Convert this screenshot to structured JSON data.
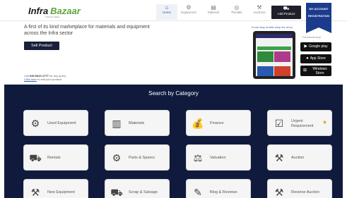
{
  "header": {
    "logo_part1": "Infra",
    "logo_part2": "Bazaar",
    "tagline": "Trees for Value",
    "nav": [
      {
        "label": "Home",
        "icon": "home-icon",
        "glyph": "⌂"
      },
      {
        "label": "Equipment",
        "icon": "gear-icon",
        "glyph": "⚙"
      },
      {
        "label": "Material",
        "icon": "box-icon",
        "glyph": "▤"
      },
      {
        "label": "Rentals",
        "icon": "rentals-icon",
        "glyph": "◎"
      },
      {
        "label": "Auctions",
        "icon": "gavel-icon",
        "glyph": "⚒"
      }
    ],
    "add_product_label": "Add Product",
    "add_product_glyph": "⛟",
    "account_label_1": "MY ACCOUNT",
    "account_label_2": "REGISTRATION"
  },
  "hero": {
    "line1": "A first of its kind marketplace for materials and equipment",
    "line2": "across the Infra sector",
    "sell_button": "Sell Product",
    "call_prefix": "Call",
    "call_number": "040 6610 1777",
    "call_suffix": "for any query",
    "click_link": "Click here",
    "click_suffix": "to add your product"
  },
  "app": {
    "tagline": "A one stop mobile shop for all yo",
    "download_label": "Download App",
    "google_play": "Google play",
    "app_store": "App Store",
    "windows_store_1": "Windows",
    "windows_store_2": "Store"
  },
  "categories": {
    "title": "Search by Category",
    "items": [
      {
        "label": "Used Equipment",
        "glyph": "⚙"
      },
      {
        "label": "Materials",
        "glyph": "▥"
      },
      {
        "label": "Finance",
        "glyph": "💰"
      },
      {
        "label_1": "Urgent",
        "label_2": "Requirement",
        "glyph": "☑",
        "star": "★"
      },
      {
        "label": "Rentals",
        "glyph": "⛟"
      },
      {
        "label": "Parts & Spares",
        "glyph": "⚙"
      },
      {
        "label": "Valuation",
        "glyph": "⚖"
      },
      {
        "label": "Auction",
        "glyph": "⚒"
      },
      {
        "label": "New Equipment",
        "glyph": "⚒"
      },
      {
        "label": "Scrap & Salvage",
        "glyph": "⛟"
      },
      {
        "label": "Blog & Reviews",
        "glyph": "✎"
      },
      {
        "label": "Reverse Auction",
        "glyph": "⚒"
      }
    ]
  },
  "colors": {
    "navy": "#0f1a3d",
    "brand_green": "#5aa63a",
    "ribbon_blue": "#1b3c8c",
    "star": "#e0a21a"
  }
}
